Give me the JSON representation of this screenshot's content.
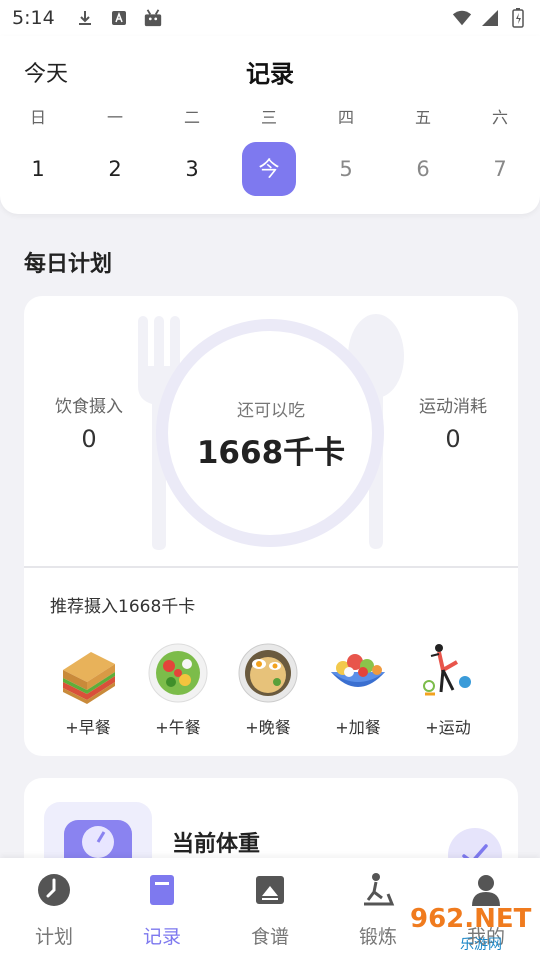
{
  "status_bar": {
    "time": "5:14"
  },
  "header": {
    "today_label": "今天",
    "title": "记录",
    "weekdays": [
      "日",
      "一",
      "二",
      "三",
      "四",
      "五",
      "六"
    ],
    "dates": [
      "1",
      "2",
      "3",
      "今",
      "5",
      "6",
      "7"
    ],
    "selected_index": 3
  },
  "daily_plan": {
    "section_title": "每日计划",
    "intake_label": "饮食摄入",
    "intake_value": "0",
    "remaining_label": "还可以吃",
    "remaining_value": "1668千卡",
    "burn_label": "运动消耗",
    "burn_value": "0",
    "recommend_text": "推荐摄入1668千卡",
    "meals": [
      {
        "label": "+早餐",
        "icon": "sandwich-icon"
      },
      {
        "label": "+午餐",
        "icon": "salad-icon"
      },
      {
        "label": "+晚餐",
        "icon": "noodles-icon"
      },
      {
        "label": "+加餐",
        "icon": "fruit-bowl-icon"
      },
      {
        "label": "+运动",
        "icon": "exercise-icon"
      }
    ]
  },
  "weight": {
    "title": "当前体重"
  },
  "tabbar": {
    "tabs": [
      {
        "label": "计划",
        "icon": "clock-icon"
      },
      {
        "label": "记录",
        "icon": "notebook-icon"
      },
      {
        "label": "食谱",
        "icon": "recipe-icon"
      },
      {
        "label": "锻炼",
        "icon": "treadmill-icon"
      },
      {
        "label": "我的",
        "icon": "profile-icon"
      }
    ],
    "active_index": 1
  },
  "watermark": {
    "line1": "962.NET",
    "line2": "乐游网"
  },
  "colors": {
    "accent": "#7e79ef",
    "background": "#f2f2f6"
  }
}
